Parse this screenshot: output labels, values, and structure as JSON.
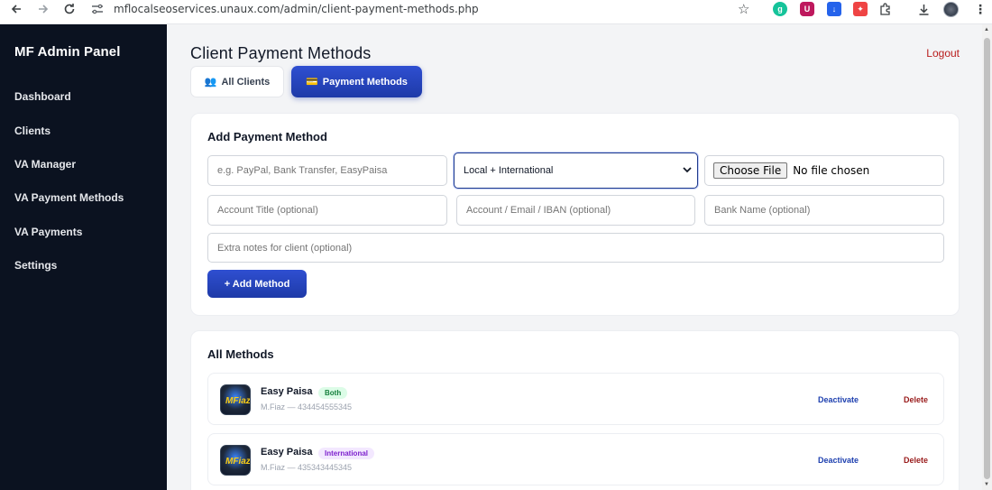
{
  "browser": {
    "url": "mflocalseoservices.unaux.com/admin/client-payment-methods.php",
    "icons": [
      "back-icon",
      "forward-icon",
      "reload-icon",
      "site-settings-icon",
      "star-icon",
      "download-icon",
      "profile-avatar",
      "menu-icon"
    ]
  },
  "sidebar": {
    "brand": "MF Admin Panel",
    "items": [
      {
        "label": "Dashboard"
      },
      {
        "label": "Clients"
      },
      {
        "label": "VA Manager"
      },
      {
        "label": "VA Payment Methods"
      },
      {
        "label": "VA Payments"
      },
      {
        "label": "Settings"
      }
    ]
  },
  "header": {
    "title": "Client Payment Methods",
    "logout": "Logout"
  },
  "tabs": [
    {
      "icon": "👥",
      "label": "All Clients",
      "active": false
    },
    {
      "icon": "💳",
      "label": "Payment Methods",
      "active": true
    }
  ],
  "form": {
    "title": "Add Payment Method",
    "name_placeholder": "e.g. PayPal, Bank Transfer, EasyPaisa",
    "scope_value": "Local + International",
    "file_button": "Choose File",
    "file_status": "No file chosen",
    "account_title_placeholder": "Account Title (optional)",
    "account_placeholder": "Account / Email / IBAN (optional)",
    "bank_placeholder": "Bank Name (optional)",
    "notes_placeholder": "Extra notes for client (optional)",
    "submit_label": "+ Add Method"
  },
  "methods": {
    "title": "All Methods",
    "items": [
      {
        "name": "Easy Paisa",
        "badge": "Both",
        "detail": "M.Fiaz — 434454555345",
        "logo_text": "MFiaz",
        "deactivate": "Deactivate",
        "delete": "Delete"
      },
      {
        "name": "Easy Paisa",
        "badge": "International",
        "detail": "M.Fiaz — 435343445345",
        "logo_text": "MFiaz",
        "deactivate": "Deactivate",
        "delete": "Delete"
      }
    ]
  },
  "colors": {
    "sidebar_bg": "#0b1220",
    "primary": "#1e3aa8",
    "logout": "#b91c1c",
    "badge_both": "#15803d",
    "badge_international": "#7e22ce"
  }
}
